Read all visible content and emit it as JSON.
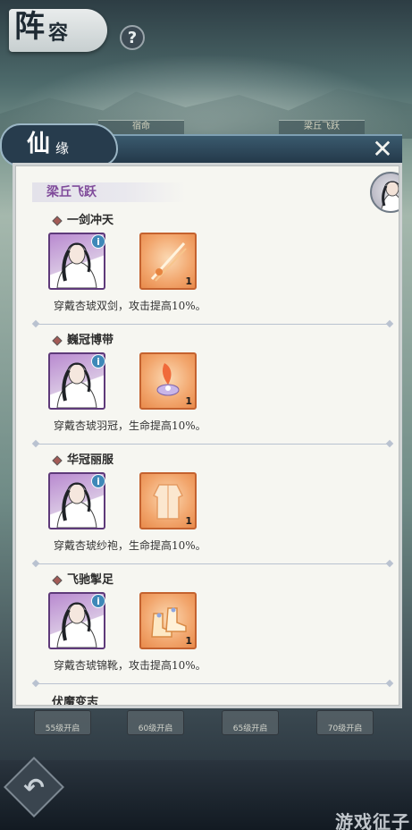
{
  "screen": {
    "title_big": "阵",
    "title_small": "容",
    "help_icon": "question-icon",
    "bg_tabs": [
      "宿命",
      "梁丘飞跃"
    ],
    "level_slots": [
      "55级开启",
      "60级开启",
      "65级开启",
      "70级开启"
    ],
    "back_icon": "back-arrow-icon",
    "watermark": "游戏征子"
  },
  "modal": {
    "title_big": "仙",
    "title_small": "缘",
    "close_icon": "close-icon",
    "section_title": "梁丘飞跃",
    "items": [
      {
        "name": "一剑冲天",
        "count": "1",
        "desc": "穿戴杏琥双剑，攻击提高10%。",
        "equip_icon": "twin-swords-icon"
      },
      {
        "name": "巍冠博带",
        "count": "1",
        "desc": "穿戴杏琥羽冠，生命提高10%。",
        "equip_icon": "feather-crown-icon"
      },
      {
        "name": "华冠丽服",
        "count": "1",
        "desc": "穿戴杏琥纱袍，生命提高10%。",
        "equip_icon": "gauze-robe-icon"
      },
      {
        "name": "飞驰掣足",
        "count": "1",
        "desc": "穿戴杏琥锦靴，攻击提高10%。",
        "equip_icon": "brocade-boots-icon"
      }
    ],
    "partial_item": "伏魔变志"
  },
  "colors": {
    "accent_purple": "#7f4a9a",
    "equip_orange": "#f2a66d",
    "header_blue": "#24394a"
  }
}
